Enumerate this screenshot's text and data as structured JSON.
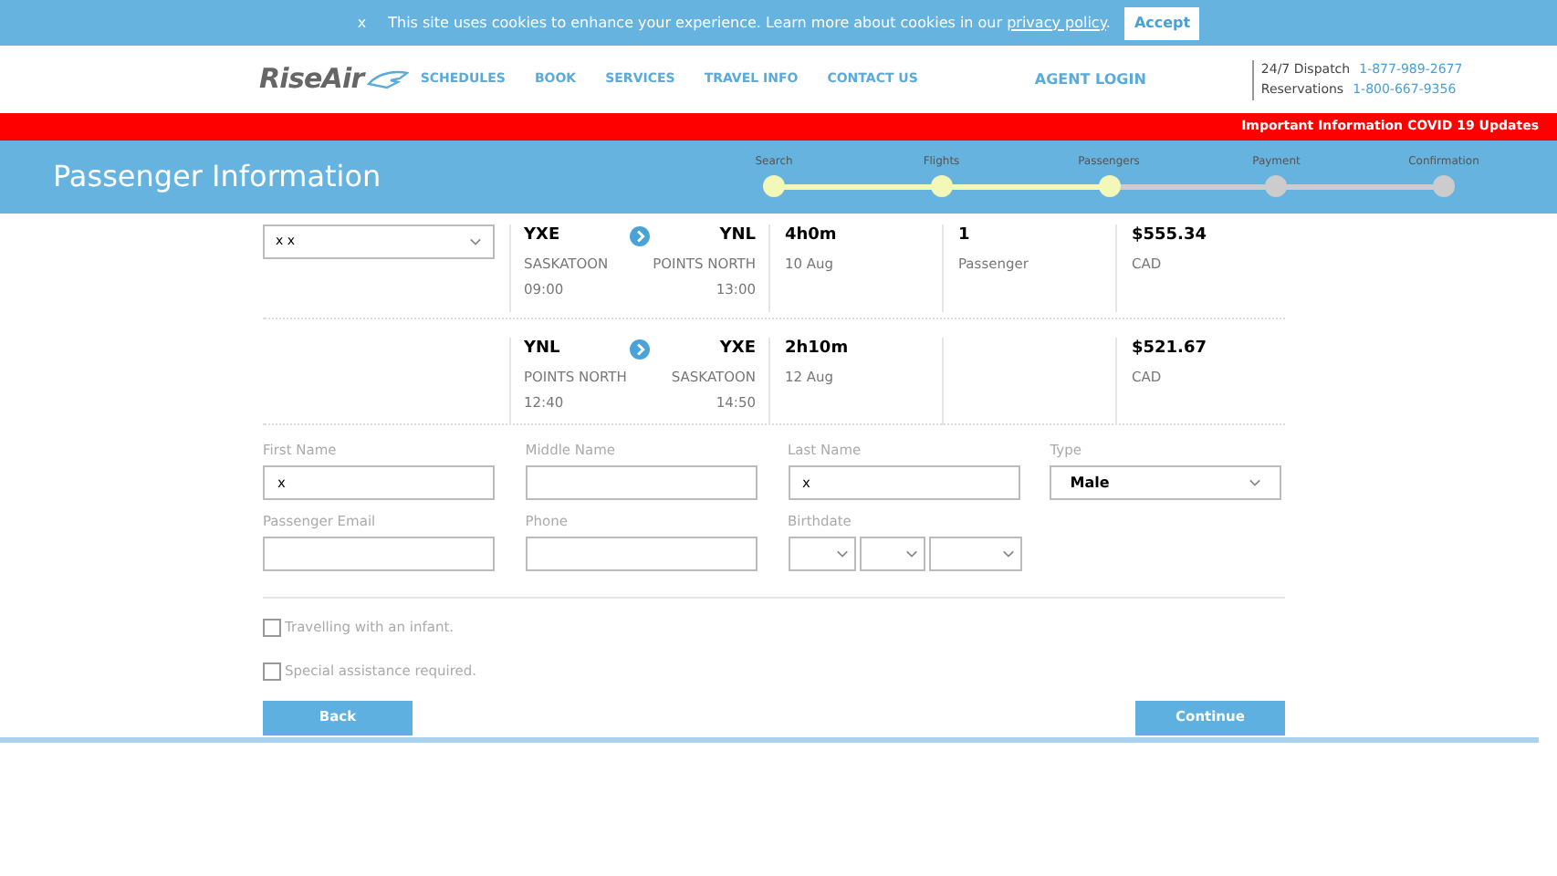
{
  "cookie_bar": {
    "close": "x",
    "message": "This site uses cookies to enhance your experience. Learn more about cookies in our ",
    "link": "privacy policy",
    "after": ".",
    "button": "Accept"
  },
  "header": {
    "logo": "RiseAir",
    "nav": [
      "SCHEDULES",
      "BOOK",
      "SERVICES",
      "TRAVEL INFO",
      "CONTACT US"
    ],
    "agent_login": "AGENT LOGIN",
    "contacts": [
      {
        "label": "24/7 Dispatch",
        "phone": "1-877-989-2677"
      },
      {
        "label": "Reservations",
        "phone": "1-800-667-9356"
      }
    ]
  },
  "alert_bar": {
    "text": "Important Information COVID 19 Updates"
  },
  "banner": {
    "title": "Passenger Information",
    "steps": [
      {
        "label": "Search",
        "completed": true
      },
      {
        "label": "Flights",
        "completed": true
      },
      {
        "label": "Passengers",
        "completed": true
      },
      {
        "label": "Payment",
        "completed": false
      },
      {
        "label": "Confirmation",
        "completed": false
      }
    ]
  },
  "passenger_select": {
    "value": "x x"
  },
  "flights": [
    {
      "from": "YXE",
      "from_city": "SASKATOON",
      "depart": "09:00",
      "to": "YNL",
      "to_city": "POINTS NORTH",
      "arrive": "13:00",
      "duration": "4h0m",
      "date": "10 Aug",
      "passengers": "1",
      "passengers_label": "Passenger",
      "price": "$555.34",
      "currency": "CAD"
    },
    {
      "from": "YNL",
      "from_city": "POINTS NORTH",
      "depart": "12:40",
      "to": "YXE",
      "to_city": "SASKATOON",
      "arrive": "14:50",
      "duration": "2h10m",
      "date": "12 Aug",
      "price": "$521.67",
      "currency": "CAD"
    }
  ],
  "fields": [
    {
      "kind": "text",
      "label": "First Name",
      "value": "x"
    },
    {
      "kind": "text",
      "label": "Middle Name"
    },
    {
      "kind": "text",
      "label": "Last Name",
      "value": "x"
    },
    {
      "kind": "select",
      "label": "Type",
      "value": "Male"
    },
    {
      "kind": "text",
      "label": "Passenger Email"
    },
    {
      "kind": "text",
      "label": "Phone"
    },
    {
      "kind": "date",
      "label": "Birthdate"
    }
  ],
  "checkboxes": [
    {
      "label": "Travelling with an infant.",
      "checked": false
    },
    {
      "label": "Special assistance required.",
      "checked": false
    }
  ],
  "buttons": {
    "back": "Back",
    "continue": "Continue"
  }
}
